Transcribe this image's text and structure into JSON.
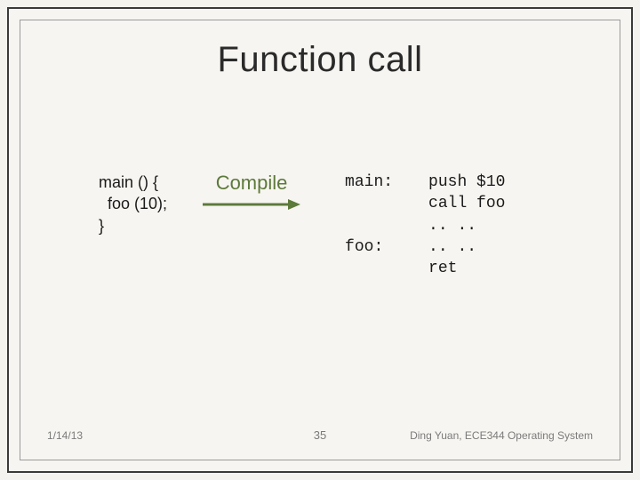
{
  "title": "Function call",
  "source_code": "main () {\n  foo (10);\n}",
  "compile_label": "Compile",
  "arrow_color": "#5c7a3a",
  "asm_labels": "main:\n\n\nfoo:",
  "asm_instructions": "push $10\ncall foo\n.. ..\n.. ..\nret",
  "footer": {
    "date": "1/14/13",
    "page": "35",
    "credit": "Ding Yuan, ECE344 Operating System"
  }
}
